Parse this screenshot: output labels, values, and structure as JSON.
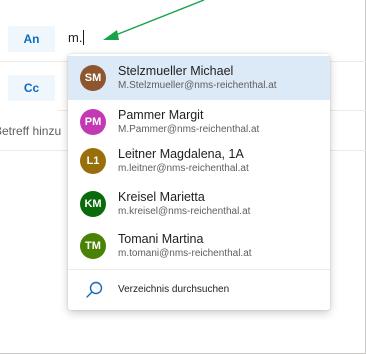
{
  "compose": {
    "to_label": "An",
    "cc_label": "Cc",
    "to_value": "m.",
    "subject_placeholder": "Betreff hinzu"
  },
  "suggestions": [
    {
      "initials": "SM",
      "name": "Stelzmueller Michael",
      "email": "M.Stelzmueller@nms-reichenthal.at",
      "color": "#8e562e",
      "selected": true
    },
    {
      "initials": "PM",
      "name": "Pammer Margit",
      "email": "M.Pammer@nms-reichenthal.at",
      "color": "#c239b3",
      "selected": false
    },
    {
      "initials": "L1",
      "name": "Leitner Magdalena, 1A",
      "email": "m.leitner@nms-reichenthal.at",
      "color": "#986f0b",
      "selected": false
    },
    {
      "initials": "KM",
      "name": "Kreisel Marietta",
      "email": "m.kreisel@nms-reichenthal.at",
      "color": "#0b6a0b",
      "selected": false
    },
    {
      "initials": "TM",
      "name": "Tomani Martina",
      "email": "m.tomani@nms-reichenthal.at",
      "color": "#498205",
      "selected": false
    }
  ],
  "directory_search": {
    "label": "Verzeichnis durchsuchen",
    "icon": "search-icon"
  },
  "colors": {
    "accent": "#0f6cbd",
    "annotation_arrow": "#16a34a"
  }
}
